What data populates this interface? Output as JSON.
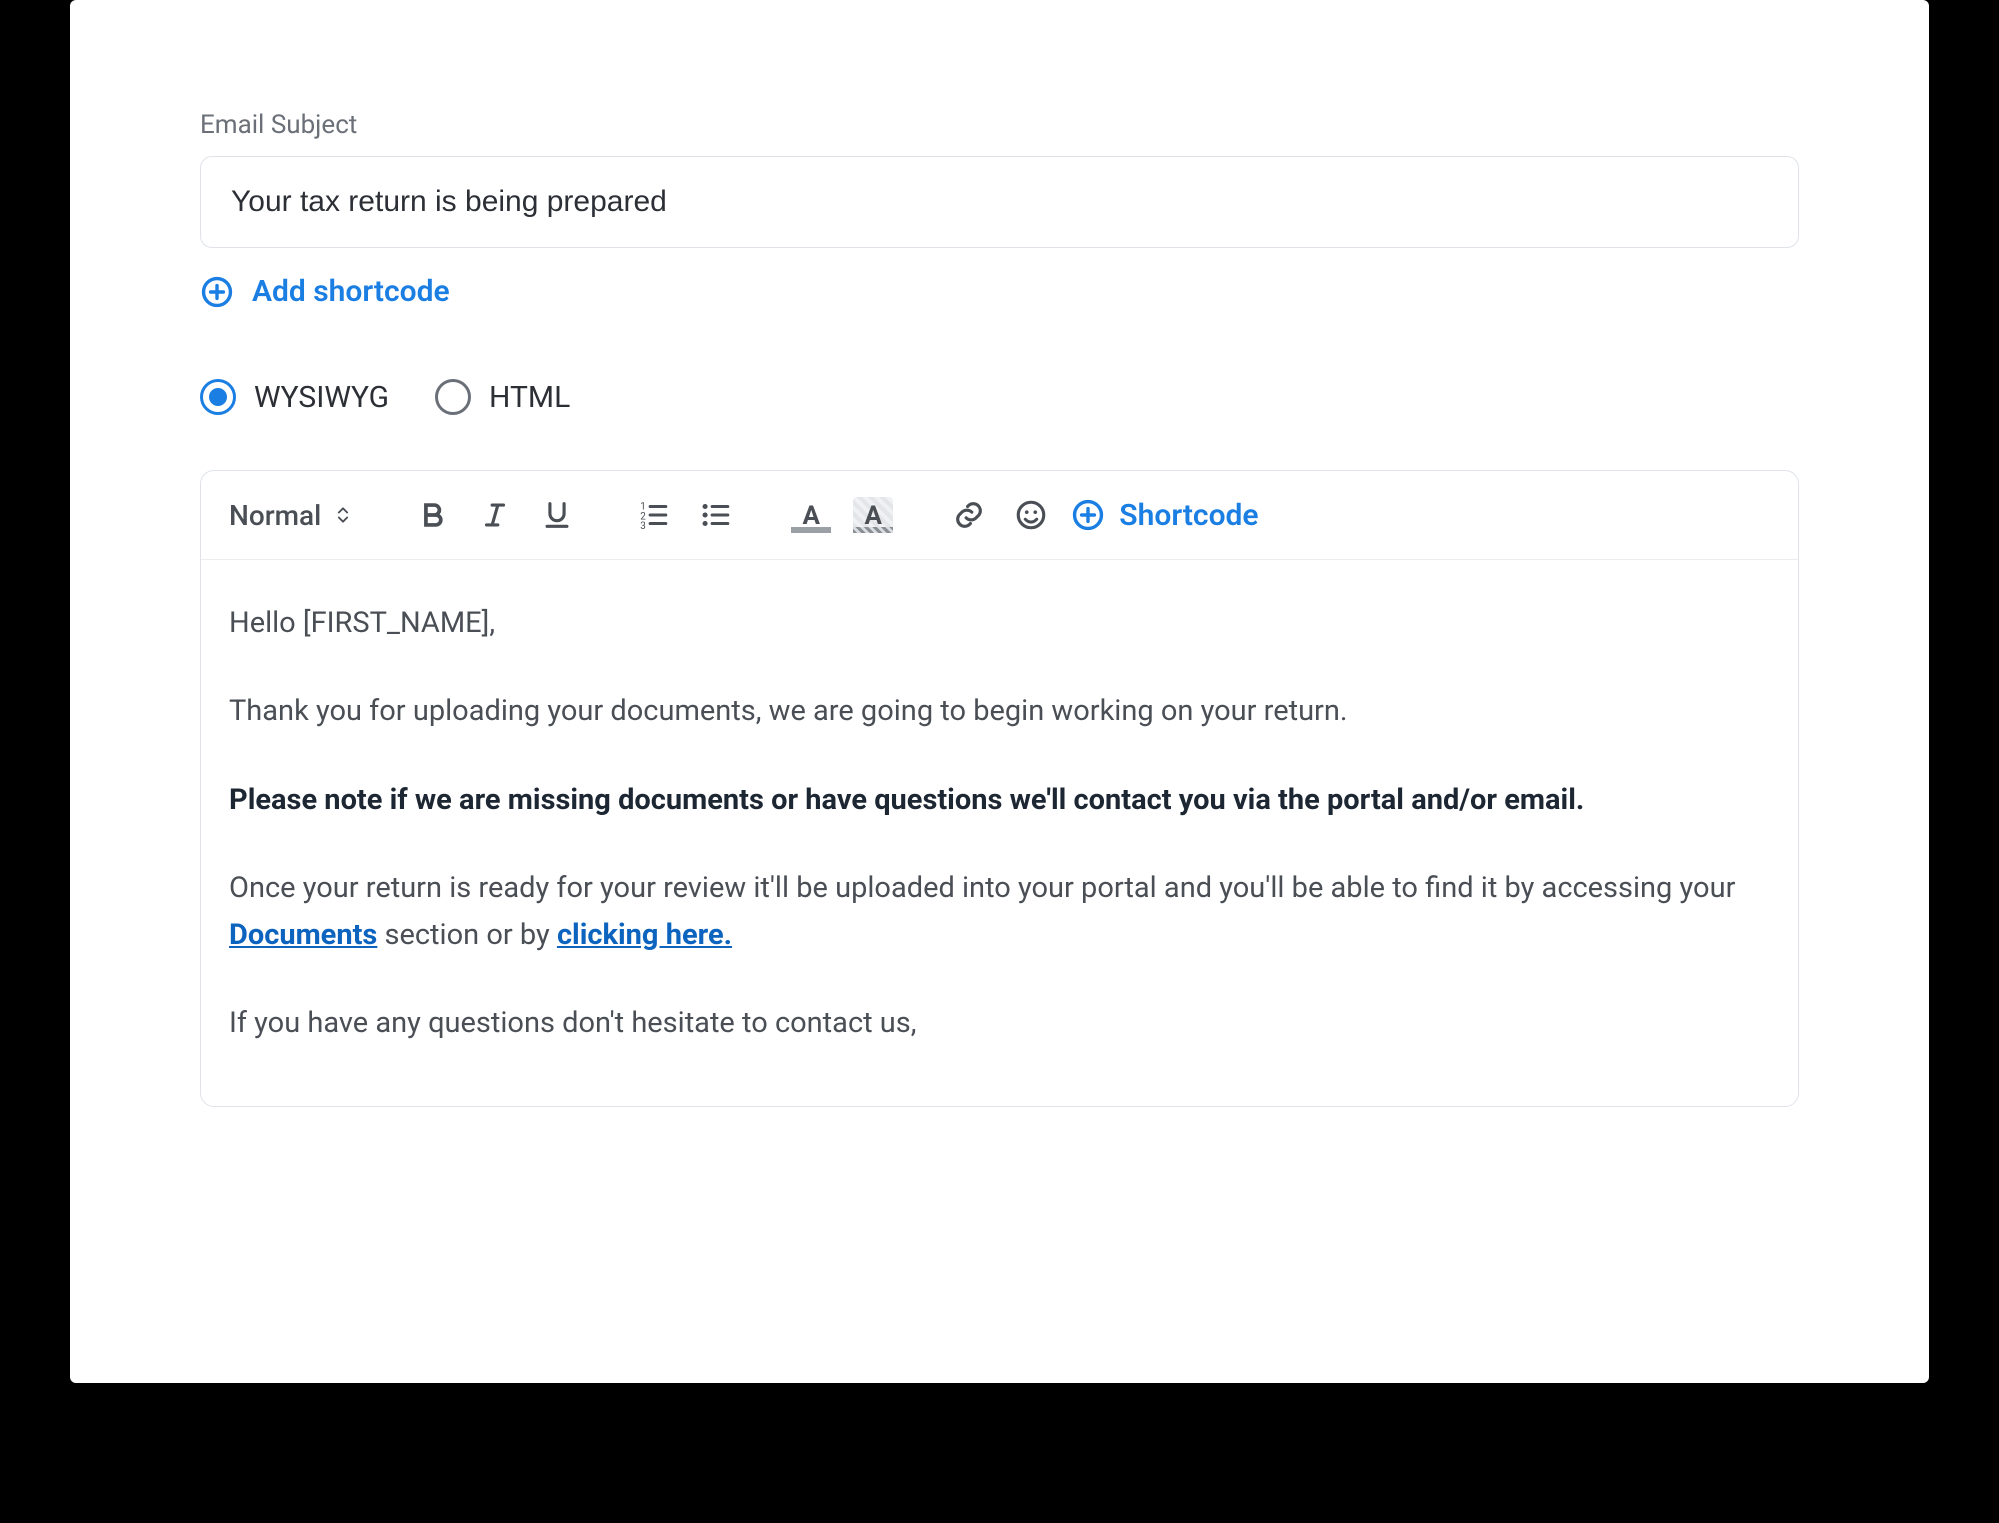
{
  "subject": {
    "label": "Email Subject",
    "value": "Your tax return is being prepared"
  },
  "add_shortcode_label": "Add shortcode",
  "mode": {
    "wysiwyg_label": "WYSIWYG",
    "html_label": "HTML",
    "selected": "wysiwyg"
  },
  "toolbar": {
    "format_label": "Normal",
    "shortcode_label": "Shortcode"
  },
  "body": {
    "p1": "Hello [FIRST_NAME],",
    "p2": "Thank you for uploading your documents, we are going to begin working on your return.",
    "p3_bold": "Please note if we are missing documents or have questions we'll contact you via the portal and/or email.",
    "p4_a": "Once your return is ready for your review it'll be uploaded into your portal and you'll be able to find it by accessing your ",
    "p4_link1": "Documents",
    "p4_b": " section or by ",
    "p4_link2": "clicking here.",
    "p5": "If you have any questions don't hesitate to contact us,"
  }
}
